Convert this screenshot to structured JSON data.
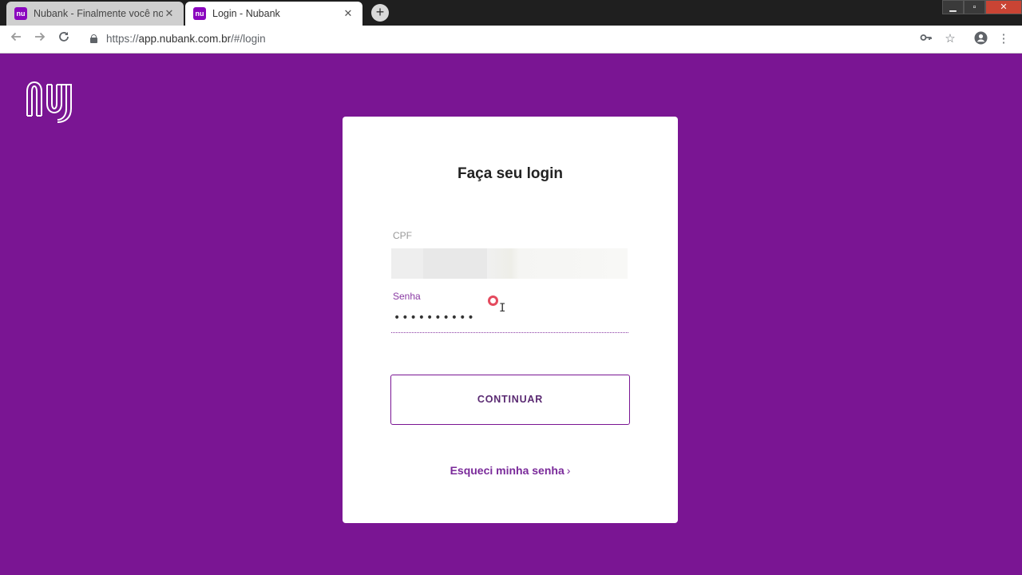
{
  "browser": {
    "tabs": [
      {
        "title": "Nubank - Finalmente você no c",
        "favicon": "nu",
        "active": false
      },
      {
        "title": "Login - Nubank",
        "favicon": "nu",
        "active": true
      }
    ],
    "new_tab": "+",
    "url_scheme": "https://",
    "url_host": "app.nubank.com.br",
    "url_path": "/#/login",
    "window_controls": {
      "minimize": "▁",
      "maximize": "▫",
      "close": "✕"
    },
    "icons": [
      "back-icon",
      "forward-icon",
      "reload-icon",
      "lock-icon",
      "key-icon",
      "star-icon",
      "account-icon",
      "menu-icon"
    ]
  },
  "login": {
    "title": "Faça seu login",
    "cpf_label": "CPF",
    "cpf_value": "",
    "senha_label": "Senha",
    "senha_value": "••••••••••",
    "continue_label": "CONTINUAR",
    "forgot_label": "Esqueci minha senha",
    "forgot_chevron": "›"
  },
  "colors": {
    "brand_purple": "#7a1593",
    "card_bg": "#ffffff",
    "link": "#7a2a9a"
  }
}
